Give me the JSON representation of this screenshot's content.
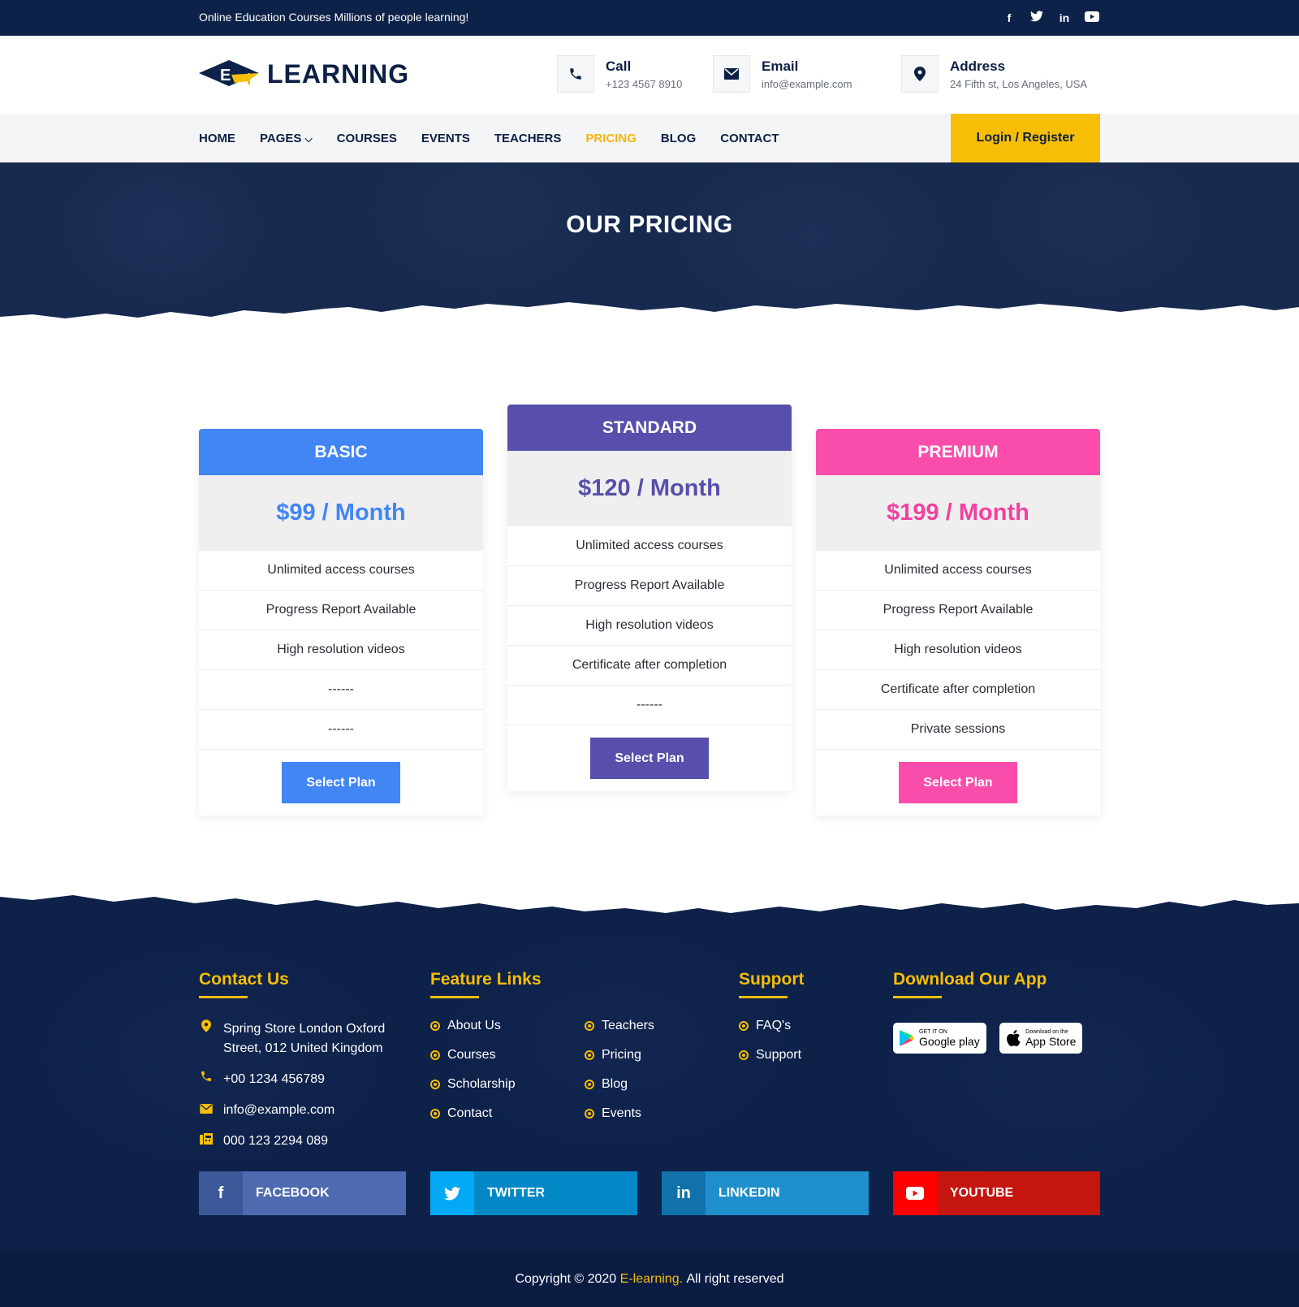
{
  "topbar": {
    "tagline": "Online Education Courses Millions of people learning!",
    "socials": [
      "facebook-icon",
      "twitter-icon",
      "linkedin-icon",
      "youtube-icon"
    ]
  },
  "header": {
    "logo_text": "LEARNING",
    "logo_letter": "E",
    "call": {
      "title": "Call",
      "value": "+123 4567 8910"
    },
    "email": {
      "title": "Email",
      "value": "info@example.com"
    },
    "address": {
      "title": "Address",
      "value": "24 Fifth st, Los Angeles, USA"
    }
  },
  "nav": {
    "items": [
      "HOME",
      "PAGES",
      "COURSES",
      "EVENTS",
      "TEACHERS",
      "PRICING",
      "BLOG",
      "CONTACT"
    ],
    "active": "PRICING",
    "login": "Login / Register"
  },
  "hero": {
    "title": "OUR PRICING"
  },
  "plans": [
    {
      "name": "BASIC",
      "price": "$99 / Month",
      "color": "#4285f4",
      "features": [
        "Unlimited access courses",
        "Progress Report Available",
        "High resolution videos",
        "------",
        "------"
      ],
      "button": "Select Plan"
    },
    {
      "name": "STANDARD",
      "price": "$120 / Month",
      "color": "#574fab",
      "features": [
        "Unlimited access courses",
        "Progress Report Available",
        "High resolution videos",
        "Certificate after completion",
        "------"
      ],
      "button": "Select Plan"
    },
    {
      "name": "PREMIUM",
      "price": "$199 / Month",
      "color": "#fa4dab",
      "features": [
        "Unlimited access courses",
        "Progress Report Available",
        "High resolution videos",
        "Certificate after completion",
        "Private sessions"
      ],
      "button": "Select Plan"
    }
  ],
  "footer": {
    "contact": {
      "title": "Contact Us",
      "address_line1": "Spring Store London Oxford",
      "address_line2": "Street, 012 United Kingdom",
      "phone": "+00 1234 456789",
      "email": "info@example.com",
      "fax": "000 123 2294 089"
    },
    "features": {
      "title": "Feature Links",
      "col1": [
        "About Us",
        "Courses",
        "Scholarship",
        "Contact"
      ],
      "col2": [
        "Teachers",
        "Pricing",
        "Blog",
        "Events"
      ]
    },
    "support": {
      "title": "Support",
      "items": [
        "FAQ's",
        "Support"
      ]
    },
    "app": {
      "title": "Download Our App",
      "google_small": "GET IT ON",
      "google_big": "Google play",
      "apple_small": "Download on the",
      "apple_big": "App Store"
    },
    "social": [
      {
        "label": "FACEBOOK",
        "icon": "facebook-icon",
        "dark": "#3b5998",
        "light": "#4e6bb1"
      },
      {
        "label": "TWITTER",
        "icon": "twitter-icon",
        "dark": "#03a9f4",
        "light": "#0288c7"
      },
      {
        "label": "LINKEDIN",
        "icon": "linkedin-icon",
        "dark": "#1071ab",
        "light": "#1f8fcb"
      },
      {
        "label": "YOUTUBE",
        "icon": "youtube-icon",
        "dark": "#ff0000",
        "light": "#c4150f"
      }
    ],
    "copyright_pre": "Copyright © 2020",
    "copyright_brand": "E-learning.",
    "copyright_post": "All right reserved"
  },
  "colors": {
    "navy": "#0c2248",
    "accent": "#f7be08"
  }
}
